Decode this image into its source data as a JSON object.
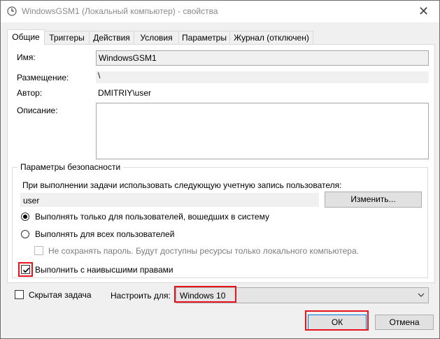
{
  "window": {
    "title": "WindowsGSM1 (Локальный компьютер) - свойства",
    "close_glyph": "✕"
  },
  "tabs": [
    {
      "label": "Общие",
      "active": true
    },
    {
      "label": "Триггеры"
    },
    {
      "label": "Действия"
    },
    {
      "label": "Условия"
    },
    {
      "label": "Параметры"
    },
    {
      "label": "Журнал (отключен)"
    }
  ],
  "general": {
    "name_label": "Имя:",
    "name_value": "WindowsGSM1",
    "location_label": "Размещение:",
    "location_value": "\\",
    "author_label": "Автор:",
    "author_value": "DMITRIY\\user",
    "description_label": "Описание:",
    "description_value": ""
  },
  "security": {
    "group_title": "Параметры безопасности",
    "account_prompt": "При выполнении задачи использовать следующую учетную запись пользователя:",
    "account_value": "user",
    "change_button": "Изменить...",
    "radio_logged_on": "Выполнять только для пользователей, вошедших в систему",
    "radio_all_users": "Выполнять для всех пользователей",
    "radio_selected": "logged_on",
    "no_store_password": "Не сохранять пароль. Будут доступны ресурсы только локального компьютера.",
    "highest_privileges": "Выполнить с наивысшими правами",
    "highest_privileges_checked": true
  },
  "bottom": {
    "hidden_task": "Скрытая задача",
    "hidden_checked": false,
    "configure_label": "Настроить для:",
    "configure_value": "Windows 10"
  },
  "buttons": {
    "ok": "ОК",
    "cancel": "Отмена"
  },
  "colors": {
    "highlight": "#e8141b",
    "ok_border": "#0078d7"
  }
}
